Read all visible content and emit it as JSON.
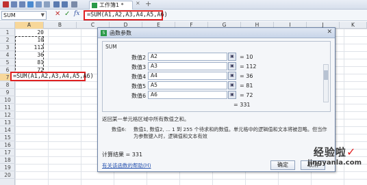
{
  "tab": {
    "title": "工作簿1 *",
    "close": "×",
    "add": "+"
  },
  "formula_bar": {
    "name_box": "SUM",
    "cancel_icon": "✕",
    "confirm_icon": "✓",
    "fx_label": "fx",
    "formula": "=SUM(A1,A2,A3,A4,A5,A6)"
  },
  "sheet": {
    "columns": [
      "A",
      "B",
      "C",
      "D",
      "E",
      "F",
      "G",
      "H",
      "I",
      "J",
      "K"
    ],
    "rows": [
      "1",
      "2",
      "3",
      "4",
      "5",
      "6",
      "7",
      "8",
      "9",
      "10",
      "11",
      "12",
      "13",
      "14",
      "15",
      "16",
      "17",
      "18",
      "19",
      "20"
    ],
    "values": [
      "20",
      "10",
      "112",
      "36",
      "81",
      "72"
    ],
    "active_cell_text": "=SUM(A1,A2,A3,A4,A5,A6)"
  },
  "dialog": {
    "title": "函数参数",
    "close_icon": "✕",
    "function_name": "SUM",
    "args": [
      {
        "label": "数值2",
        "ref": "A2",
        "value": "= 10"
      },
      {
        "label": "数值3",
        "ref": "A3",
        "value": "= 112"
      },
      {
        "label": "数值4",
        "ref": "A4",
        "value": "= 36"
      },
      {
        "label": "数值5",
        "ref": "A5",
        "value": "= 81"
      },
      {
        "label": "数值6",
        "ref": "A6",
        "value": "= 72"
      }
    ],
    "result": "= 331",
    "description": "返回某一单元格区域中所有数值之和。",
    "param_name": "数值6:",
    "param_desc": "数值1, 数值2, ... 1 到 255 个待求和的数值。单元格中的逻辑值和文本将被忽略。但当作为参数键入时，逻辑值和文本有效",
    "calc_result": "计算结果 = 331",
    "help_link": "有关该函数的帮助(H)",
    "ok_label": "确定",
    "cancel_label": "取消"
  },
  "watermark": {
    "title": "经验啦",
    "check": "✓",
    "url": "jingyanla.com"
  }
}
